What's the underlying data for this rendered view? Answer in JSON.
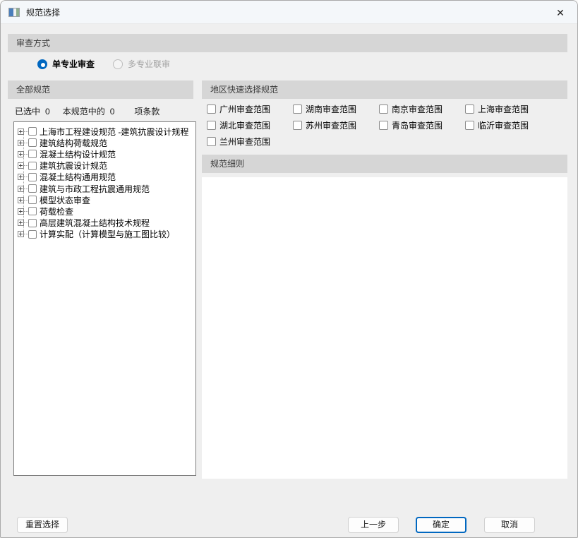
{
  "window": {
    "title": "规范选择",
    "close_glyph": "✕"
  },
  "review_mode": {
    "header": "审查方式",
    "options": [
      {
        "label": "单专业审查",
        "selected": true
      },
      {
        "label": "多专业联审",
        "selected": false
      }
    ]
  },
  "all_specs": {
    "header": "全部规范",
    "counts": {
      "selected_label": "已选中",
      "selected_count": "0",
      "of_label": "本规范中的",
      "of_count": "0",
      "suffix_label": "项条款"
    },
    "tree": [
      "上海市工程建设规范 -建筑抗震设计规程",
      "建筑结构荷载规范",
      "混凝土结构设计规范",
      "建筑抗震设计规范",
      "混凝土结构通用规范",
      "建筑与市政工程抗震通用规范",
      "模型状态审查",
      "荷载检查",
      "高层建筑混凝土结构技术规程",
      "计算实配（计算模型与施工图比较）"
    ]
  },
  "regions": {
    "header": "地区快速选择规范",
    "items": [
      "广州审查范围",
      "湖南审查范围",
      "南京审查范围",
      "上海审查范围",
      "湖北审查范围",
      "苏州审查范围",
      "青岛审查范围",
      "临沂审查范围",
      "兰州审查范围"
    ]
  },
  "details": {
    "header": "规范细则"
  },
  "footer": {
    "reset": "重置选择",
    "prev": "上一步",
    "ok": "确定",
    "cancel": "取消"
  },
  "colors": {
    "accent": "#0067c0",
    "header_bg": "#d6d6d6",
    "dialog_bg": "#efefef"
  }
}
